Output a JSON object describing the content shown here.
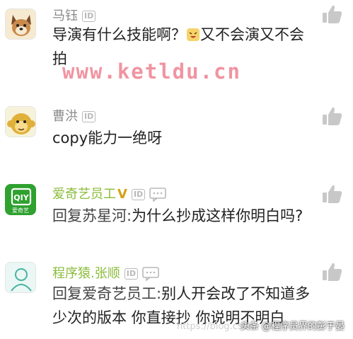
{
  "comments": [
    {
      "name": "马钰",
      "text_line1": "导演有什么技能啊？",
      "text_line2": "又不会演又不会",
      "text_line3": "拍",
      "avatar": "dog-avatar"
    },
    {
      "name": "曹洪",
      "text_line1": "copy能力一绝呀",
      "avatar": "monkey-avatar"
    },
    {
      "name": "爱奇艺员工",
      "reply_prefix": "回复苏星河:",
      "text_line1": "为什么抄成这样你明白吗?",
      "avatar": "iqiyi-avatar",
      "avatar_text": "爱奇艺"
    },
    {
      "name": "程序猿.张顺",
      "reply_prefix": "回复爱奇艺员工:",
      "text_line1": "别人开会改了不知道多",
      "text_line2": "少次的版本 你直接抄 你说明不明白",
      "avatar": "person-avatar"
    }
  ],
  "badge_label": "ID",
  "watermark": "www.ketldu.cn",
  "footer_url": "https://blog.csdn",
  "footer_credit": "头条 @程序员界的彭于晏",
  "colors": {
    "name_gray": "#8a8a8a",
    "name_green": "#8bbc3a",
    "watermark": "#f08f9c"
  }
}
